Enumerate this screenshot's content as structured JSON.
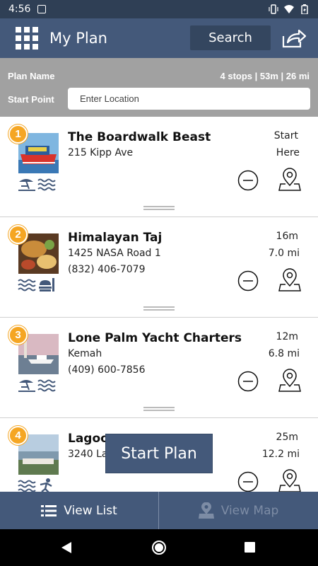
{
  "status_bar": {
    "time": "4:56"
  },
  "app_bar": {
    "title": "My Plan",
    "search_label": "Search"
  },
  "plan": {
    "name_label": "Plan Name",
    "summary": "4 stops | 53m | 26 mi",
    "start_point_label": "Start Point",
    "start_point_placeholder": "Enter Location",
    "start_point_value": ""
  },
  "stops": [
    {
      "number": "1",
      "name": "The Boardwalk Beast",
      "address": "215 Kipp Ave",
      "phone": "",
      "time": "Start",
      "distance": "Here",
      "amenities": [
        "beach-icon",
        "water-icon"
      ]
    },
    {
      "number": "2",
      "name": "Himalayan Taj",
      "address": "1425 NASA Road 1",
      "phone": "(832) 406-7079",
      "time": "16m",
      "distance": "7.0 mi",
      "amenities": [
        "water-icon",
        "dining-icon"
      ]
    },
    {
      "number": "3",
      "name": "Lone Palm Yacht Charters",
      "address": "Kemah",
      "phone": "(409) 600-7856",
      "time": "12m",
      "distance": "6.8 mi",
      "amenities": [
        "beach-icon",
        "water-icon"
      ]
    },
    {
      "number": "4",
      "name": "Lagoon",
      "address": "3240 La",
      "phone": "",
      "time": "25m",
      "distance": "12.2 mi",
      "amenities": [
        "water-icon",
        "activity-icon"
      ]
    }
  ],
  "start_plan_label": "Start Plan",
  "tabs": {
    "list_label": "View List",
    "map_label": "View Map"
  },
  "colors": {
    "app_bar": "#44597a",
    "badge": "#f5a623",
    "header_gray": "#a1a1a1",
    "status_bar": "#2f3f55"
  }
}
